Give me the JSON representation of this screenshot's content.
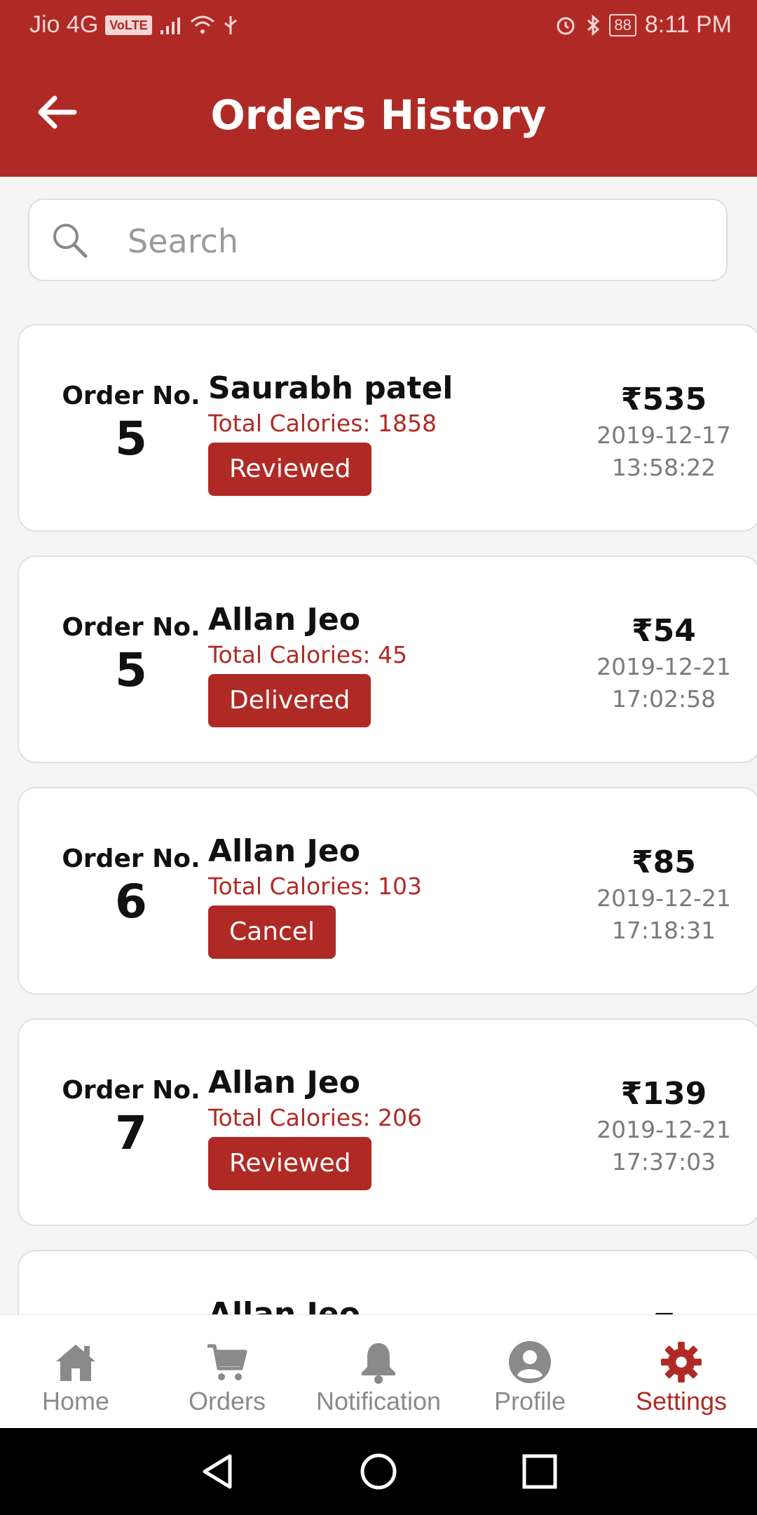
{
  "status_bar": {
    "carrier": "Jio 4G",
    "volte": "VoLTE",
    "battery": "88",
    "time": "8:11 PM"
  },
  "header": {
    "title": "Orders History"
  },
  "search": {
    "placeholder": "Search"
  },
  "orders": [
    {
      "order_label": "Order No.",
      "order_no": "5",
      "customer": "Saurabh patel",
      "calories": "Total Calories: 1858",
      "status": "Reviewed",
      "price": "₹535",
      "date": "2019-12-17",
      "time": "13:58:22"
    },
    {
      "order_label": "Order No.",
      "order_no": "5",
      "customer": "Allan Jeo",
      "calories": "Total Calories: 45",
      "status": "Delivered",
      "price": "₹54",
      "date": "2019-12-21",
      "time": "17:02:58"
    },
    {
      "order_label": "Order No.",
      "order_no": "6",
      "customer": "Allan Jeo",
      "calories": "Total Calories: 103",
      "status": "Cancel",
      "price": "₹85",
      "date": "2019-12-21",
      "time": "17:18:31"
    },
    {
      "order_label": "Order No.",
      "order_no": "7",
      "customer": "Allan Jeo",
      "calories": "Total Calories: 206",
      "status": "Reviewed",
      "price": "₹139",
      "date": "2019-12-21",
      "time": "17:37:03"
    },
    {
      "customer": "Allan Jeo",
      "price": "₹"
    }
  ],
  "tabs": [
    {
      "label": "Home",
      "icon": "home-icon"
    },
    {
      "label": "Orders",
      "icon": "cart-icon"
    },
    {
      "label": "Notification",
      "icon": "bell-icon"
    },
    {
      "label": "Profile",
      "icon": "profile-icon"
    },
    {
      "label": "Settings",
      "icon": "gear-icon",
      "active": true
    }
  ],
  "colors": {
    "primary": "#b02a25",
    "muted": "#8a8a8a"
  }
}
